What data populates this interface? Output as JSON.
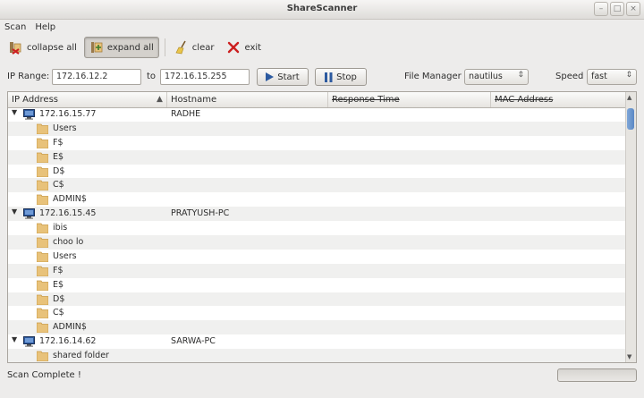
{
  "window": {
    "title": "ShareScanner",
    "min_glyph": "–",
    "max_glyph": "□",
    "close_glyph": "×"
  },
  "menu": [
    {
      "label": "Scan"
    },
    {
      "label": "Help"
    }
  ],
  "toolbar": {
    "collapse_all": "collapse all",
    "expand_all": "expand all",
    "clear": "clear",
    "exit": "exit"
  },
  "params": {
    "ip_range_label": "IP Range:",
    "ip_start": "172.16.12.2",
    "to_label": "to",
    "ip_end": "172.16.15.255",
    "start_label": "Start",
    "stop_label": "Stop",
    "file_manager_label": "File Manager",
    "file_manager_value": "nautilus",
    "speed_label": "Speed",
    "speed_value": "fast"
  },
  "columns": {
    "ip": "IP Address",
    "hostname": "Hostname",
    "response_time": "Response Time",
    "mac": "MAC Address"
  },
  "rows": [
    {
      "type": "host",
      "ip": "172.16.15.77",
      "hostname": "RADHE"
    },
    {
      "type": "share",
      "name": "Users"
    },
    {
      "type": "share",
      "name": "F$"
    },
    {
      "type": "share",
      "name": "E$"
    },
    {
      "type": "share",
      "name": "D$"
    },
    {
      "type": "share",
      "name": "C$"
    },
    {
      "type": "share",
      "name": "ADMIN$"
    },
    {
      "type": "host",
      "ip": "172.16.15.45",
      "hostname": "PRATYUSH-PC"
    },
    {
      "type": "share",
      "name": "ibis"
    },
    {
      "type": "share",
      "name": "choo lo"
    },
    {
      "type": "share",
      "name": "Users"
    },
    {
      "type": "share",
      "name": "F$"
    },
    {
      "type": "share",
      "name": "E$"
    },
    {
      "type": "share",
      "name": "D$"
    },
    {
      "type": "share",
      "name": "C$"
    },
    {
      "type": "share",
      "name": "ADMIN$"
    },
    {
      "type": "host",
      "ip": "172.16.14.62",
      "hostname": "SARWA-PC"
    },
    {
      "type": "share",
      "name": "shared folder"
    }
  ],
  "status": {
    "text": "Scan Complete !",
    "progress": 0
  },
  "colors": {
    "folder": "#e8c27a",
    "folder_dark": "#c99a45",
    "monitor": "#2c5aa0",
    "stop_blue": "#2c5aa0",
    "exit_red": "#cc1f1f"
  }
}
